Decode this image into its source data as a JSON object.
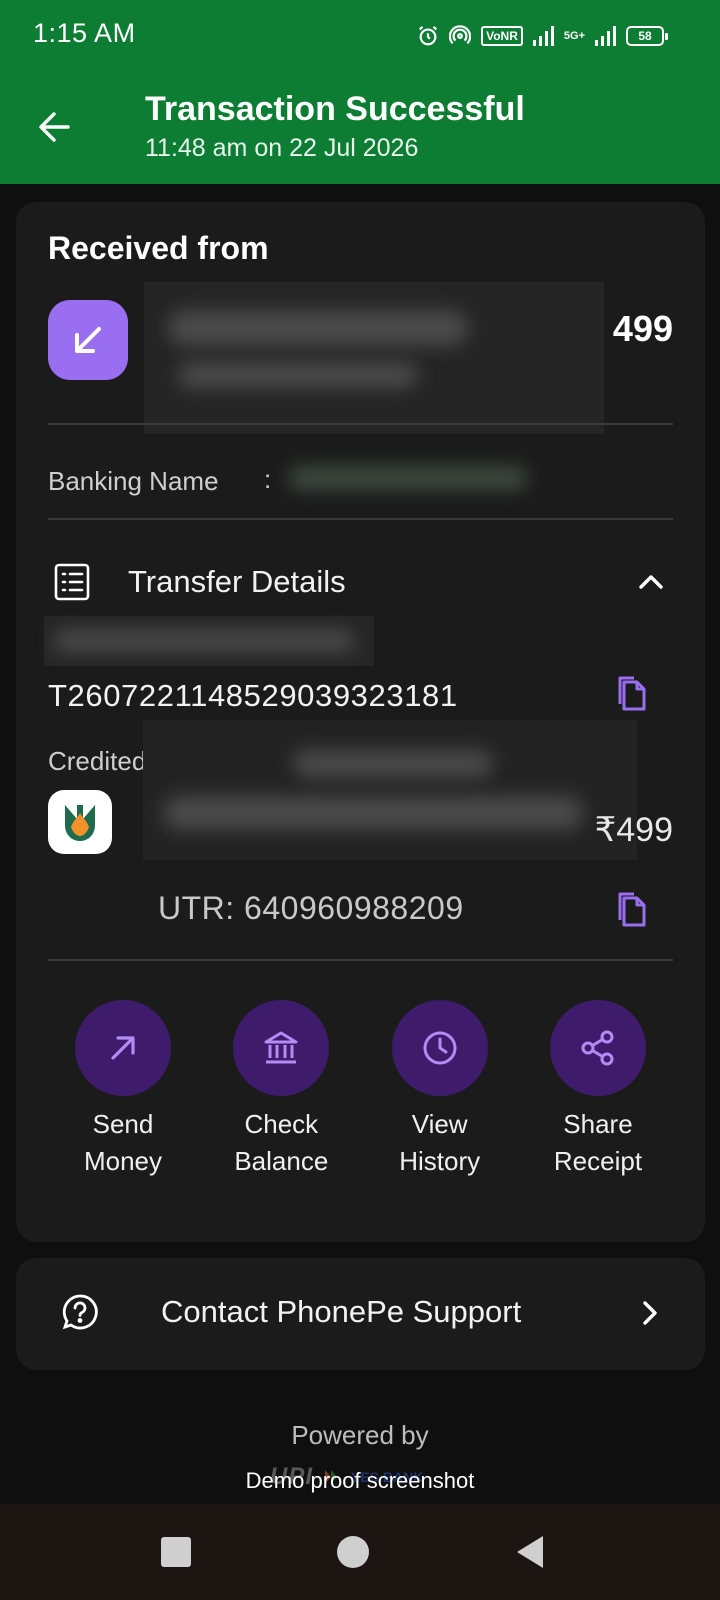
{
  "status_bar": {
    "time": "1:15 AM",
    "vonr": "VoNR",
    "network": "5G+",
    "battery": "58"
  },
  "header": {
    "title": "Transaction Successful",
    "subtitle": "11:48 am on 22 Jul 2026",
    "back_icon": "arrow-left-icon",
    "background": "#0d7d34"
  },
  "received": {
    "label": "Received from",
    "amount": "499",
    "icon": "arrow-down-left-icon",
    "accent": "#9a6ef0"
  },
  "banking": {
    "label": "Banking Name",
    "colon": ":"
  },
  "transfer": {
    "label": "Transfer Details",
    "transaction_id": "T2607221148529039323181",
    "credited_label": "Credited",
    "amount": "₹499",
    "utr": "UTR: 640960988209"
  },
  "actions": [
    {
      "line1": "Send",
      "line2": "Money",
      "icon": "arrow-up-right-icon"
    },
    {
      "line1": "Check",
      "line2": "Balance",
      "icon": "bank-icon"
    },
    {
      "line1": "View",
      "line2": "History",
      "icon": "clock-icon"
    },
    {
      "line1": "Share",
      "line2": "Receipt",
      "icon": "share-icon"
    }
  ],
  "support": {
    "label": "Contact PhonePe Support"
  },
  "footer": {
    "powered_by": "Powered by",
    "demo": "Demo proof screenshot"
  }
}
